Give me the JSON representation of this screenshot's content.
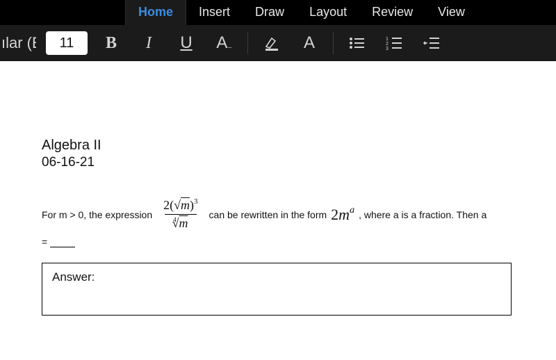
{
  "ribbon": {
    "tabs": [
      "Home",
      "Insert",
      "Draw",
      "Layout",
      "Review",
      "View"
    ]
  },
  "toolbar": {
    "font_name": "ılar (E",
    "font_size": "11"
  },
  "document": {
    "heading": "Algebra II",
    "date": "06-16-21",
    "p1": "For m > 0, the expression",
    "p2": "can be rewritten in the form",
    "p3": ", where a is a fraction.  Then a",
    "eq": "=",
    "frac_num_coef": "2",
    "frac_num_radicand": "m",
    "frac_num_paren_open": "(",
    "frac_num_paren_close": ")",
    "frac_num_exp": "3",
    "frac_den_index": "4",
    "frac_den_radicand": "m",
    "form_coef": "2",
    "form_var": "m",
    "form_exp": "a",
    "answer_label": "Answer:"
  }
}
